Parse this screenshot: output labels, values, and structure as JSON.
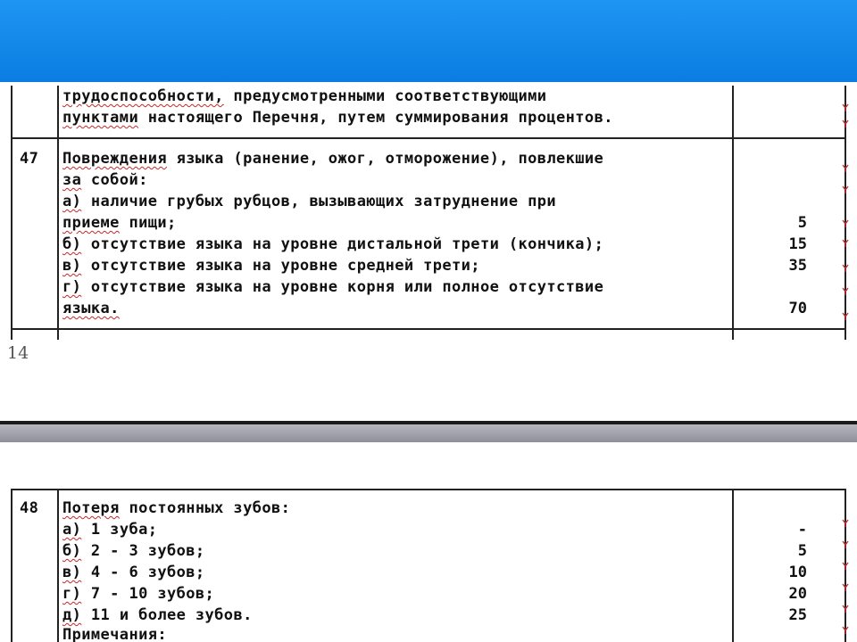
{
  "page_number": "14",
  "section1": {
    "continuation_lines": [
      "трудоспособности, предусмотренными соответствующими",
      "пунктами настоящего Перечня, путем суммирования процентов."
    ],
    "item": {
      "number": "47",
      "lines": [
        "Повреждения языка (ранение, ожог, отморожение), повлекшие",
        "за собой:",
        "а) наличие грубых рубцов, вызывающих затруднение при",
        "приеме пищи;",
        "б) отсутствие языка на уровне дистальной трети (кончика);",
        "в) отсутствие языка на уровне средней трети;",
        "г) отсутствие языка на уровне корня или полное отсутствие",
        "языка."
      ],
      "values": [
        "5",
        "15",
        "35",
        "70"
      ]
    }
  },
  "section2": {
    "item": {
      "number": "48",
      "lines": [
        "Потеря постоянных зубов:",
        "а) 1 зуба;",
        "б) 2 - 3 зубов;",
        "в) 4 - 6 зубов;",
        "г) 7 - 10 зубов;",
        "д) 11 и более зубов.",
        "Примечания:"
      ],
      "values": [
        "-",
        "5",
        "10",
        "20",
        "25"
      ]
    }
  },
  "colors": {
    "header_blue": "#1589eb",
    "separator_gray": "#a3a3ab",
    "spell_wave": "#c62828"
  },
  "icons": [
    "spellcheck-wave-icon"
  ]
}
